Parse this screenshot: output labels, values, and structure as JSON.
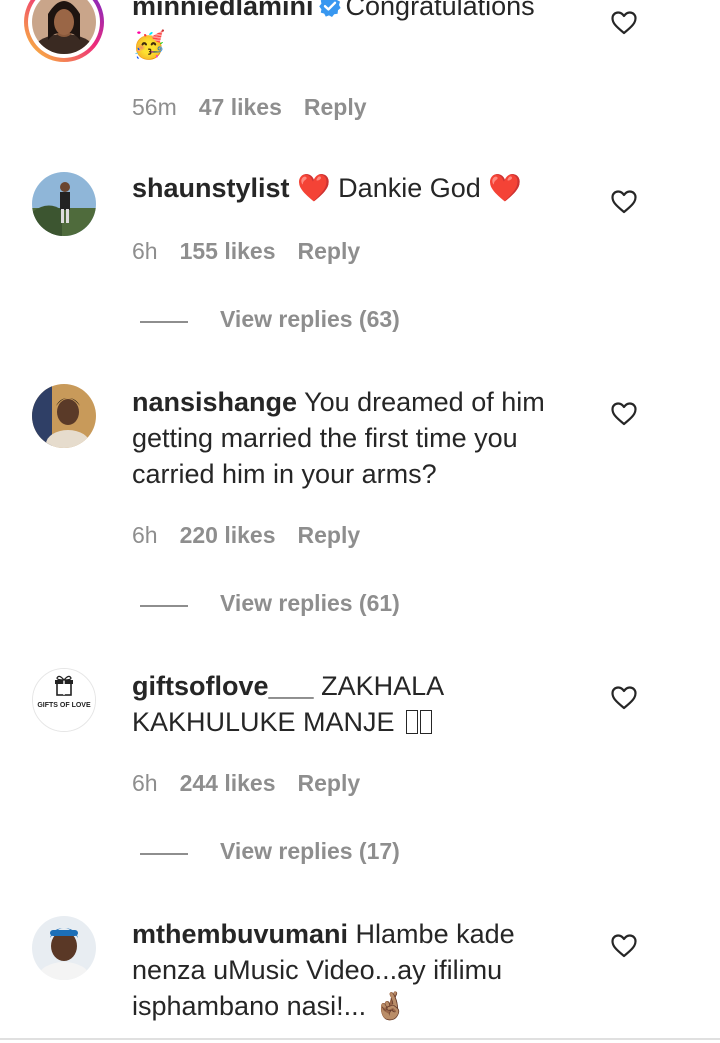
{
  "comments": [
    {
      "username": "minniedlamini",
      "verified": true,
      "text": "Congratulations",
      "emoji": "🥳",
      "time": "56m",
      "likes": "47 likes",
      "reply": "Reply"
    },
    {
      "username": "shaunstylist",
      "text": "❤️ Dankie God ❤️",
      "time": "6h",
      "likes": "155 likes",
      "reply": "Reply",
      "view_replies": "View replies (63)"
    },
    {
      "username": "nansishange",
      "text_line1": "You dreamed of him",
      "text_line2": "getting married the first time you",
      "text_line3": "carried him in your arms?",
      "time": "6h",
      "likes": "220 likes",
      "reply": "Reply",
      "view_replies": "View replies (61)"
    },
    {
      "username": "giftsoflove___",
      "avatar_text": "GIFTS OF LOVE",
      "text_line1": "ZAKHALA",
      "text_line2": "KAKHULUKE MANJE",
      "time": "6h",
      "likes": "244 likes",
      "reply": "Reply",
      "view_replies": "View replies (17)"
    },
    {
      "username": "mthembuvumani",
      "text_line1": "Hlambe kade",
      "text_line2": "nenza uMusic Video...ay ifilimu",
      "text_line3": "isphambano nasi!...",
      "emoji": "🤞🏽"
    }
  ],
  "colors": {
    "text": "#262626",
    "secondary": "#8e8e8e",
    "verified": "#3897f0",
    "heart_red": "#ed4956"
  },
  "icons": [
    "heart-outline-icon",
    "verified-badge-icon"
  ]
}
